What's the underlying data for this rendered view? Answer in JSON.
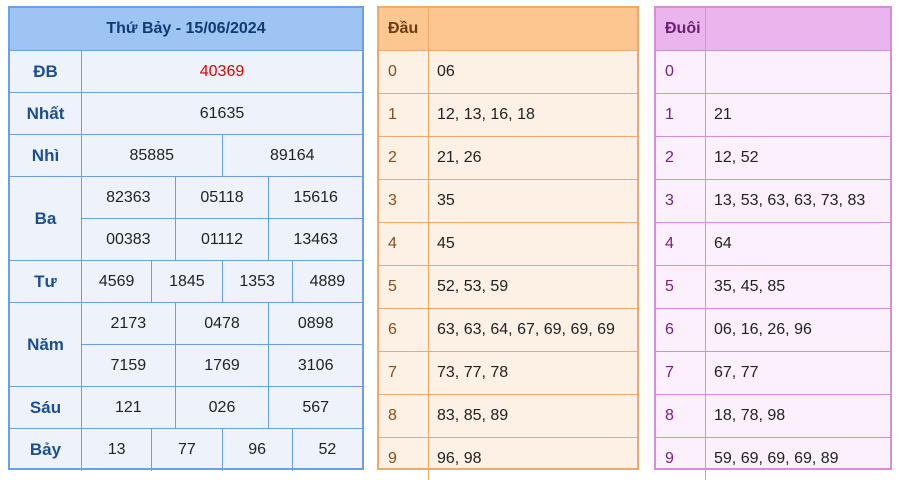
{
  "results": {
    "header": "Thứ Bảy - 15/06/2024",
    "rows": [
      {
        "label": "ĐB",
        "lines": [
          [
            "40369"
          ]
        ]
      },
      {
        "label": "Nhất",
        "lines": [
          [
            "61635"
          ]
        ]
      },
      {
        "label": "Nhì",
        "lines": [
          [
            "85885",
            "89164"
          ]
        ]
      },
      {
        "label": "Ba",
        "lines": [
          [
            "82363",
            "05118",
            "15616"
          ],
          [
            "00383",
            "01112",
            "13463"
          ]
        ]
      },
      {
        "label": "Tư",
        "lines": [
          [
            "4569",
            "1845",
            "1353",
            "4889"
          ]
        ]
      },
      {
        "label": "Năm",
        "lines": [
          [
            "2173",
            "0478",
            "0898"
          ],
          [
            "7159",
            "1769",
            "3106"
          ]
        ]
      },
      {
        "label": "Sáu",
        "lines": [
          [
            "121",
            "026",
            "567"
          ]
        ]
      },
      {
        "label": "Bảy",
        "lines": [
          [
            "13",
            "77",
            "96",
            "52"
          ]
        ]
      }
    ],
    "special_color": "#e00000"
  },
  "dau": {
    "header": "Đầu",
    "rows": [
      {
        "digit": "0",
        "values": "06"
      },
      {
        "digit": "1",
        "values": "12, 13, 16, 18"
      },
      {
        "digit": "2",
        "values": "21, 26"
      },
      {
        "digit": "3",
        "values": "35"
      },
      {
        "digit": "4",
        "values": "45"
      },
      {
        "digit": "5",
        "values": "52, 53, 59"
      },
      {
        "digit": "6",
        "values": "63, 63, 64, 67, 69, 69, 69"
      },
      {
        "digit": "7",
        "values": "73, 77, 78"
      },
      {
        "digit": "8",
        "values": "83, 85, 89"
      },
      {
        "digit": "9",
        "values": "96, 98"
      }
    ]
  },
  "duoi": {
    "header": "Đuôi",
    "rows": [
      {
        "digit": "0",
        "values": ""
      },
      {
        "digit": "1",
        "values": "21"
      },
      {
        "digit": "2",
        "values": "12, 52"
      },
      {
        "digit": "3",
        "values": "13, 53, 63, 63, 73, 83"
      },
      {
        "digit": "4",
        "values": "64"
      },
      {
        "digit": "5",
        "values": "35, 45, 85"
      },
      {
        "digit": "6",
        "values": "06, 16, 26, 96"
      },
      {
        "digit": "7",
        "values": "67, 77"
      },
      {
        "digit": "8",
        "values": "18, 78, 98"
      },
      {
        "digit": "9",
        "values": "59, 69, 69, 69, 89"
      }
    ]
  }
}
